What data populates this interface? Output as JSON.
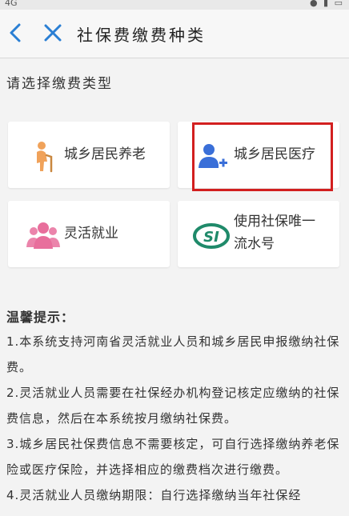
{
  "status_bar": {
    "left": "4G",
    "right": "● ▮ ▭"
  },
  "header": {
    "title": "社保费缴费种类"
  },
  "section_label": "请选择缴费类型",
  "options": [
    {
      "label": "城乡居民养老",
      "icon": "elderly-person-icon"
    },
    {
      "label": "城乡居民医疗",
      "icon": "person-add-icon"
    },
    {
      "label": "灵活就业",
      "icon": "people-group-icon"
    },
    {
      "label_line1": "使用社保唯一",
      "label_line2": "流水号",
      "icon": "si-logo-icon"
    }
  ],
  "tips": {
    "title": "温馨提示：",
    "items": [
      "1.本系统支持河南省灵活就业人员和城乡居民申报缴纳社保费。",
      "2.灵活就业人员需要在社保经办机构登记核定应缴纳的社保费信息，然后在本系统按月缴纳社保费。",
      "3.城乡居民社保费信息不需要核定，可自行选择缴纳养老保险或医疗保险，并选择相应的缴费档次进行缴费。",
      "4.灵活就业人员缴纳期限：自行选择缴纳当年社保经"
    ]
  },
  "colors": {
    "accent": "#2a7fd4",
    "highlight": "#d21f1f",
    "si_green": "#1f8a6a",
    "pink": "#e86f9c",
    "orange": "#f0a25a",
    "blue_icon": "#3a6fd8"
  }
}
